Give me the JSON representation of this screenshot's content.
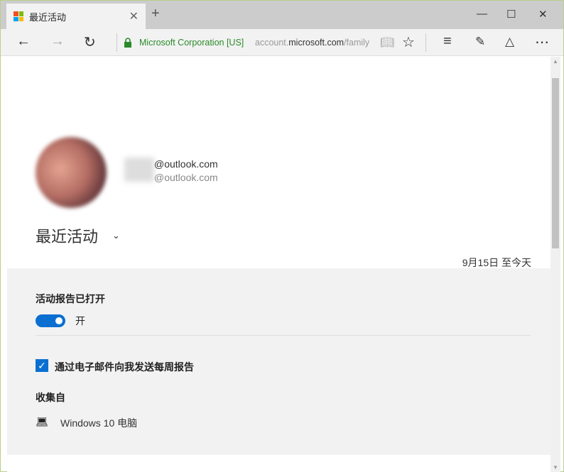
{
  "tab": {
    "title": "最近活动"
  },
  "address": {
    "org": "Microsoft Corporation [US]",
    "url_prefix": "account.",
    "url_domain": "microsoft.com",
    "url_path": "/family"
  },
  "profile": {
    "email1": "@outlook.com",
    "email2": "@outlook.com"
  },
  "page": {
    "title": "最近活动",
    "date_range": "9月15日 至今天"
  },
  "settings": {
    "report_label": "活动报告已打开",
    "toggle_state": "开",
    "toggle_on": true,
    "email_label": "通过电子邮件向我发送每周报告",
    "email_checked": true,
    "collected_label": "收集自",
    "device": "Windows 10 电脑"
  },
  "colors": {
    "accent": "#0a6fd1",
    "secure": "#2a8a2a"
  }
}
